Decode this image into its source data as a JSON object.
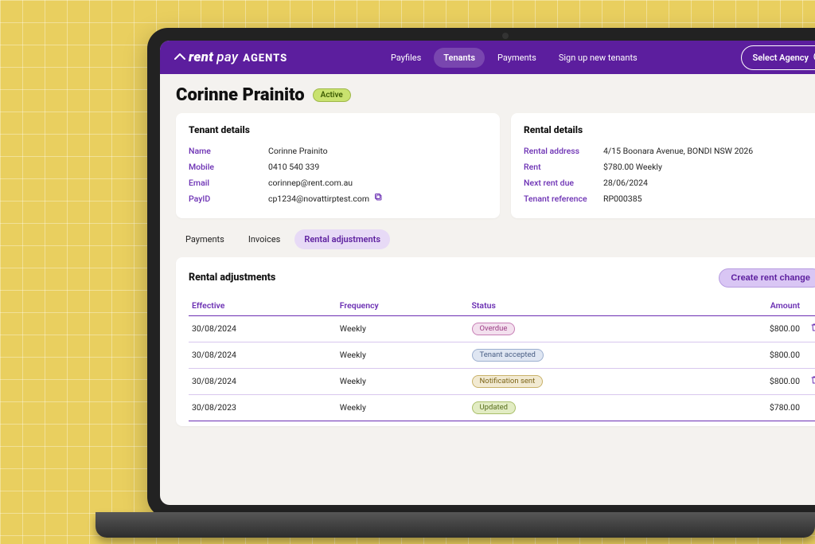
{
  "header": {
    "logo": {
      "rent": "rent",
      "pay": "pay",
      "agents": "AGENTS"
    },
    "nav": [
      {
        "label": "Payfiles",
        "active": false
      },
      {
        "label": "Tenants",
        "active": true
      },
      {
        "label": "Payments",
        "active": false
      },
      {
        "label": "Sign up new tenants",
        "active": false
      }
    ],
    "select_agency": "Select Agency"
  },
  "title": "Corinne Prainito",
  "status": "Active",
  "tenant_details": {
    "heading": "Tenant details",
    "name_label": "Name",
    "name": "Corinne Prainito",
    "mobile_label": "Mobile",
    "mobile": "0410 540 339",
    "email_label": "Email",
    "email": "corinnep@rent.com.au",
    "payid_label": "PayID",
    "payid": "cp1234@novattirptest.com"
  },
  "rental_details": {
    "heading": "Rental details",
    "address_label": "Rental address",
    "address": "4/15 Boonara Avenue, BONDI NSW 2026",
    "rent_label": "Rent",
    "rent": "$780.00  Weekly",
    "due_label": "Next rent due",
    "due": "28/06/2024",
    "ref_label": "Tenant reference",
    "ref": "RP000385"
  },
  "tabs": [
    {
      "label": "Payments",
      "active": false
    },
    {
      "label": "Invoices",
      "active": false
    },
    {
      "label": "Rental adjustments",
      "active": true
    }
  ],
  "panel": {
    "title": "Rental adjustments",
    "create_label": "Create rent change",
    "columns": {
      "effective": "Effective",
      "frequency": "Frequency",
      "status": "Status",
      "amount": "Amount"
    },
    "rows": [
      {
        "effective": "30/08/2024",
        "frequency": "Weekly",
        "status": "Overdue",
        "status_class": "b-overdue",
        "amount": "$800.00",
        "deletable": true
      },
      {
        "effective": "30/08/2024",
        "frequency": "Weekly",
        "status": "Tenant accepted",
        "status_class": "b-accepted",
        "amount": "$800.00",
        "deletable": false
      },
      {
        "effective": "30/08/2024",
        "frequency": "Weekly",
        "status": "Notification sent",
        "status_class": "b-notif",
        "amount": "$800.00",
        "deletable": true
      },
      {
        "effective": "30/08/2023",
        "frequency": "Weekly",
        "status": "Updated",
        "status_class": "b-updated",
        "amount": "$780.00",
        "deletable": false
      }
    ]
  }
}
